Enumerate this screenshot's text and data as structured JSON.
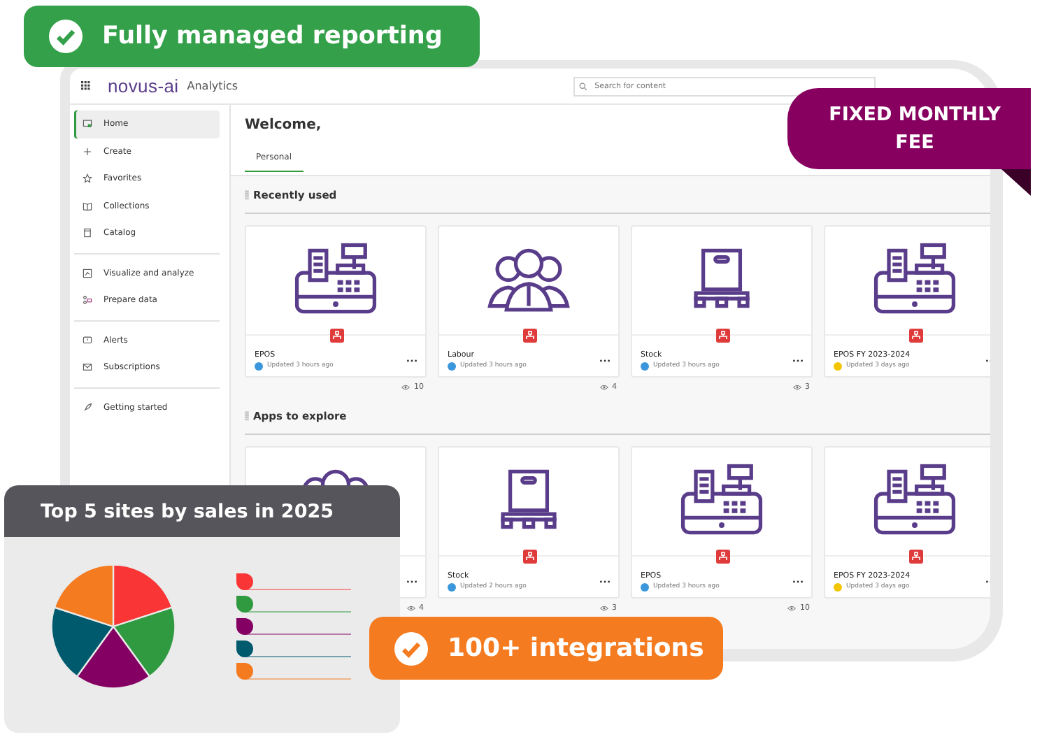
{
  "top_badge": {
    "text": "Fully managed reporting"
  },
  "fee_badge": {
    "text": "FIXED MONTHLY FEE"
  },
  "bottom_badge": {
    "text": "100+ integrations"
  },
  "app": {
    "logo": "novus-ai",
    "product": "Analytics",
    "search": {
      "placeholder": "Search for content"
    },
    "sidebar": {
      "groups": [
        [
          {
            "label": "Home",
            "kind": "home",
            "selected": true
          },
          {
            "label": "Create",
            "kind": "plus",
            "selected": false
          },
          {
            "label": "Favorites",
            "kind": "star",
            "selected": false
          },
          {
            "label": "Collections",
            "kind": "book",
            "selected": false
          },
          {
            "label": "Catalog",
            "kind": "catalog",
            "selected": false
          }
        ],
        [
          {
            "label": "Visualize and analyze",
            "kind": "chart",
            "selected": false
          },
          {
            "label": "Prepare data",
            "kind": "data",
            "selected": false
          }
        ],
        [
          {
            "label": "Alerts",
            "kind": "alert",
            "selected": false
          },
          {
            "label": "Subscriptions",
            "kind": "mail",
            "selected": false
          }
        ],
        [
          {
            "label": "Getting started",
            "kind": "rocket",
            "selected": false
          }
        ]
      ]
    },
    "welcome": "Welcome,",
    "tabs": [
      {
        "label": "Personal",
        "selected": true
      }
    ],
    "sections": [
      {
        "title": "Recently used",
        "cards": [
          {
            "kind": "register",
            "name": "EPOS",
            "updated": "Updated 3 hours ago",
            "color": "#3a97dc",
            "views": "10"
          },
          {
            "kind": "people",
            "name": "Labour",
            "updated": "Updated 3 hours ago",
            "color": "#3a97dc",
            "views": "4"
          },
          {
            "kind": "box",
            "name": "Stock",
            "updated": "Updated 3 hours ago",
            "color": "#3a97dc",
            "views": "3"
          },
          {
            "kind": "register",
            "name": "EPOS FY 2023-2024",
            "updated": "Updated 3 days ago",
            "color": "#f2c500"
          }
        ]
      },
      {
        "title": "Apps to explore",
        "cards": [
          {
            "kind": "people",
            "views": "4"
          },
          {
            "kind": "box",
            "name": "Stock",
            "updated": "Updated 2 hours ago",
            "color": "#3a97dc",
            "views": "3"
          },
          {
            "kind": "register",
            "name": "EPOS",
            "updated": "Updated 3 hours ago",
            "color": "#3a97dc",
            "views": "10"
          },
          {
            "kind": "register",
            "name": "EPOS FY 2023-2024",
            "updated": "Updated 3 days ago",
            "color": "#f2c500"
          }
        ]
      }
    ]
  },
  "chart_panel": {
    "title": "Top 5 sites by sales in 2025",
    "legend": [
      {
        "color": "#f93535"
      },
      {
        "color": "#2f9a40"
      },
      {
        "color": "#850063"
      },
      {
        "color": "#005a6e"
      },
      {
        "color": "#f47b20"
      }
    ]
  }
}
